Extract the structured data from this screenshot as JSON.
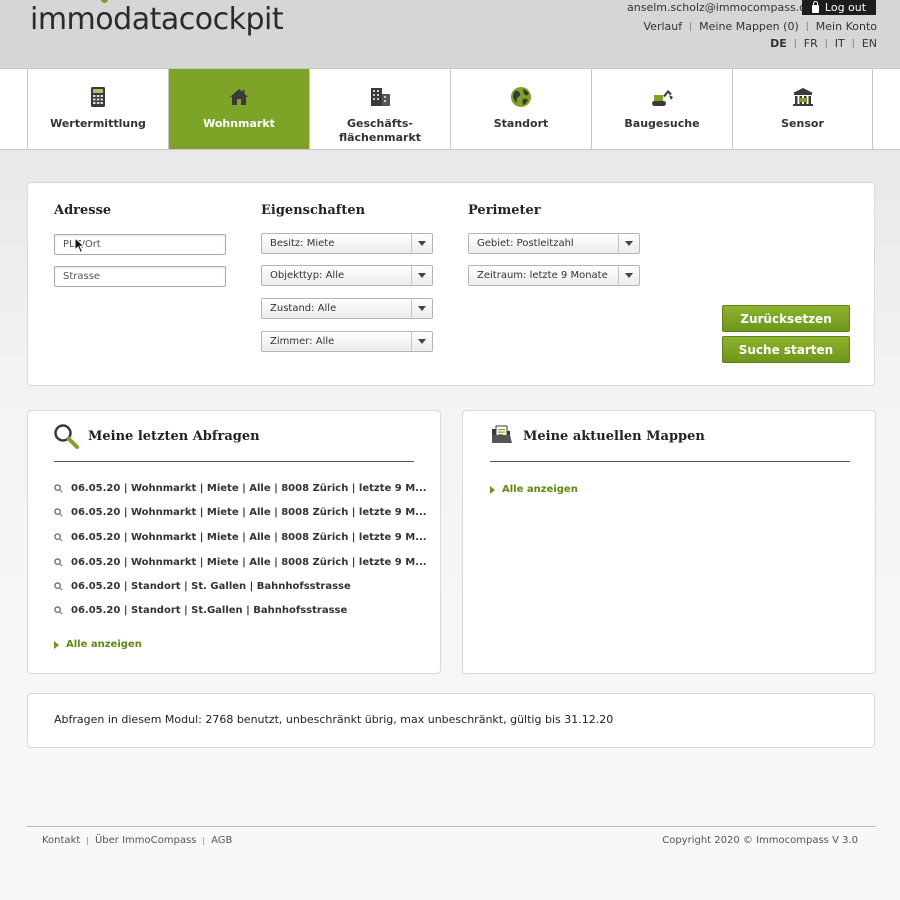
{
  "header": {
    "logo_part1": "imm",
    "logo_o": "o",
    "logo_part2": "datacockpit",
    "user_email": "anselm.scholz@immocompass.ch",
    "logout_label": "Log out",
    "links": [
      "Verlauf",
      "Meine Mappen (0)",
      "Mein Konto"
    ],
    "languages": [
      "DE",
      "FR",
      "IT",
      "EN"
    ],
    "active_language": "DE"
  },
  "nav": {
    "items": [
      {
        "label": "Wertermittlung",
        "icon": "calculator-icon"
      },
      {
        "label": "Wohnmarkt",
        "icon": "house-icon",
        "active": true
      },
      {
        "label": "Geschäfts-\nflächenmarkt",
        "icon": "office-building-icon"
      },
      {
        "label": "Standort",
        "icon": "globe-icon"
      },
      {
        "label": "Baugesuche",
        "icon": "excavator-icon"
      },
      {
        "label": "Sensor",
        "icon": "bank-building-icon"
      }
    ]
  },
  "search": {
    "adresse_title": "Adresse",
    "plz_placeholder": "PLZ/Ort",
    "strasse_placeholder": "Strasse",
    "eigenschaften_title": "Eigenschaften",
    "besitz": "Besitz: Miete",
    "objekttyp": "Objekttyp: Alle",
    "zustand": "Zustand: Alle",
    "zimmer": "Zimmer: Alle",
    "perimeter_title": "Perimeter",
    "gebiet": "Gebiet: Postleitzahl",
    "zeitraum": "Zeitraum: letzte 9 Monate",
    "reset_label": "Zurücksetzen",
    "start_label": "Suche starten"
  },
  "recent": {
    "title": "Meine letzten Abfragen",
    "items": [
      "06.05.20 | Wohnmarkt | Miete | Alle | 8008 Zürich | letzte 9 M...",
      "06.05.20 | Wohnmarkt | Miete | Alle | 8008 Zürich | letzte 9 M...",
      "06.05.20 | Wohnmarkt | Miete | Alle | 8008 Zürich | letzte 9 M...",
      "06.05.20 | Wohnmarkt | Miete | Alle | 8008 Zürich | letzte 9 M...",
      "06.05.20 | Standort | St. Gallen | Bahnhofsstrasse",
      "06.05.20 | Standort | St.Gallen | Bahnhofsstrasse"
    ],
    "show_all": "Alle anzeigen"
  },
  "folders": {
    "title": "Meine aktuellen Mappen",
    "show_all": "Alle anzeigen"
  },
  "quota": {
    "text": "Abfragen in diesem Modul: 2768 benutzt, unbeschränkt übrig, max unbeschränkt, gültig bis 31.12.20"
  },
  "footer": {
    "links": [
      "Kontakt",
      "Über ImmoCompass",
      "AGB"
    ],
    "copyright": "Copyright 2020 © Immocompass V 3.0"
  },
  "colors": {
    "accent": "#7da426",
    "accent_dark": "#6e961c"
  }
}
